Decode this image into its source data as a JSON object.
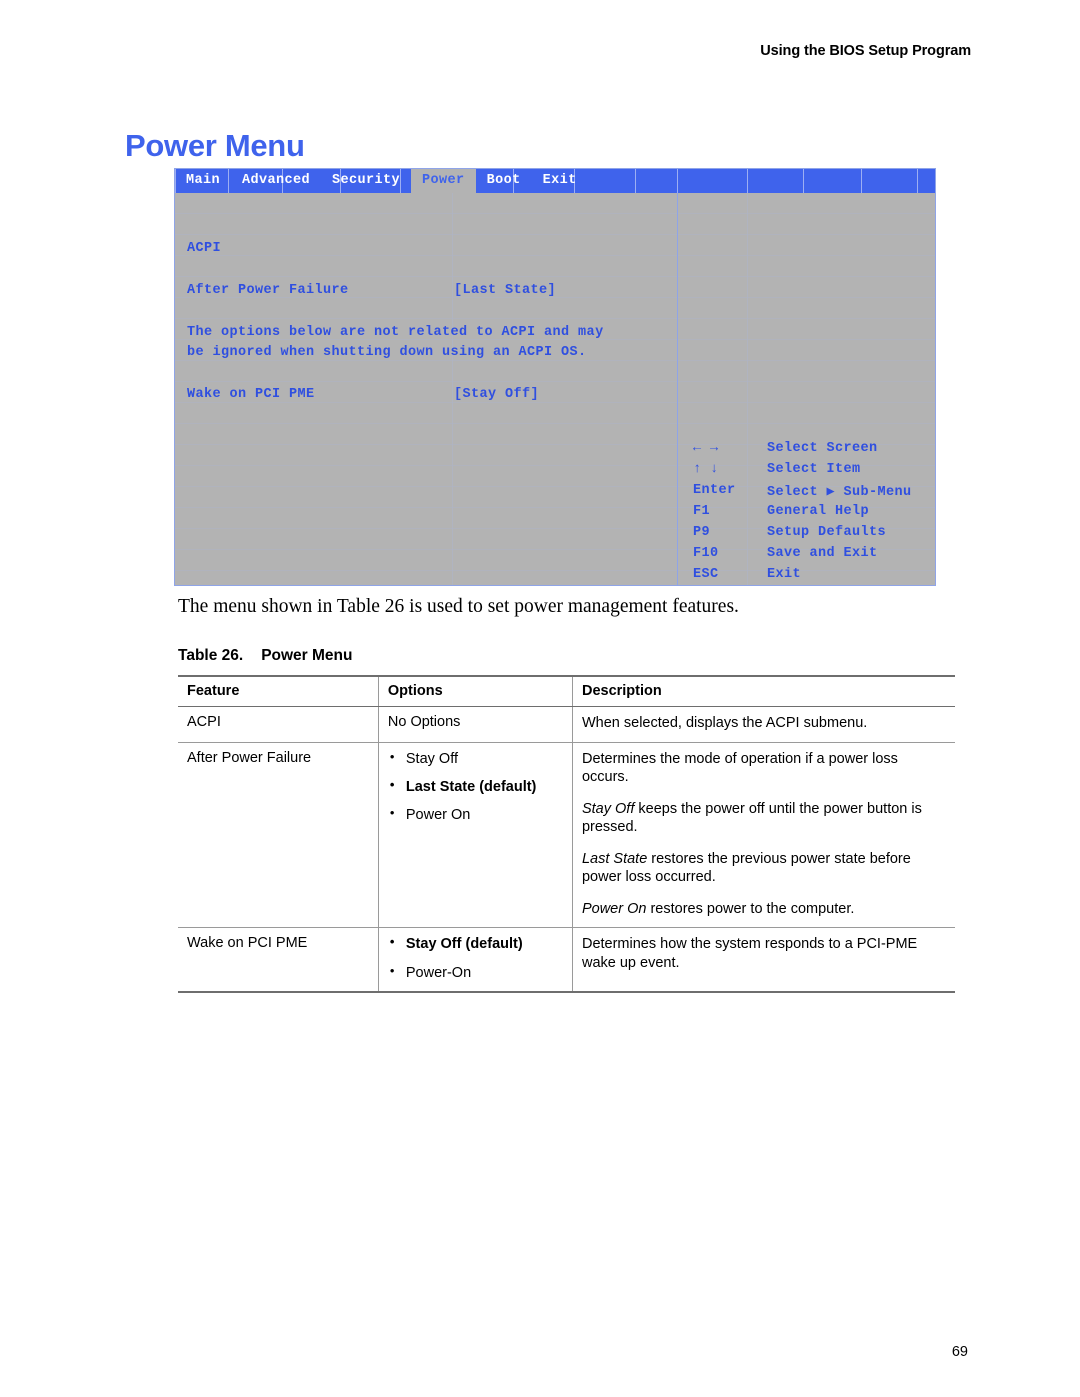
{
  "header": {
    "running_head": "Using the BIOS Setup Program"
  },
  "page_heading": "Power Menu",
  "bios_screen": {
    "tabs": [
      {
        "label": "Main",
        "selected": false
      },
      {
        "label": "Advanced",
        "selected": false
      },
      {
        "label": "Security",
        "selected": false
      },
      {
        "label": "Power",
        "selected": true
      },
      {
        "label": "Boot",
        "selected": false
      },
      {
        "label": "Exit",
        "selected": false
      }
    ],
    "items": [
      {
        "name": "ACPI",
        "value": ""
      },
      {
        "name": "After Power Failure",
        "value": "[Last State]"
      },
      {
        "name": "Wake on PCI PME",
        "value": "[Stay Off]"
      }
    ],
    "note_line1": "The options below are not related to ACPI and may",
    "note_line2": "be ignored when shutting down using an ACPI OS.",
    "help_keys": [
      {
        "key": "← →",
        "action": "Select Screen"
      },
      {
        "key": "↑ ↓",
        "action": "Select Item"
      },
      {
        "key": "Enter",
        "action": "Select ▶ Sub-Menu"
      },
      {
        "key": "F1",
        "action": "General Help"
      },
      {
        "key": "P9",
        "action": "Setup Defaults"
      },
      {
        "key": "F10",
        "action": "Save and Exit"
      },
      {
        "key": "ESC",
        "action": "Exit"
      }
    ],
    "colors": {
      "menubar_blue": "#3f63ec",
      "body_gray": "#b3b3b3",
      "text_blue": "#2f4fe0"
    }
  },
  "paragraph": "The menu shown in Table 26 is used to set power management features.",
  "table_caption": {
    "number": "Table 26.",
    "title": "Power Menu"
  },
  "table": {
    "headers": [
      "Feature",
      "Options",
      "Description"
    ],
    "rows": [
      {
        "feature": "ACPI",
        "options": [
          {
            "text": "No Options",
            "bullet": false,
            "bold": false
          }
        ],
        "description": [
          [
            {
              "t": "When selected, displays the ACPI submenu.",
              "i": false
            }
          ]
        ]
      },
      {
        "feature": "After Power Failure",
        "options": [
          {
            "text": "Stay Off",
            "bullet": true,
            "bold": false
          },
          {
            "text": "Last State (default)",
            "bullet": true,
            "bold": true
          },
          {
            "text": "Power On",
            "bullet": true,
            "bold": false
          }
        ],
        "description": [
          [
            {
              "t": "Determines the mode of operation if a power loss occurs.",
              "i": false
            }
          ],
          [
            {
              "t": "Stay Off",
              "i": true
            },
            {
              "t": " keeps the power off until the power button is pressed.",
              "i": false
            }
          ],
          [
            {
              "t": "Last State",
              "i": true
            },
            {
              "t": " restores the previous power state before power loss occurred.",
              "i": false
            }
          ],
          [
            {
              "t": "Power On",
              "i": true
            },
            {
              "t": " restores power to the computer.",
              "i": false
            }
          ]
        ]
      },
      {
        "feature": "Wake on PCI PME",
        "options": [
          {
            "text": "Stay Off (default)",
            "bullet": true,
            "bold": true
          },
          {
            "text": "Power-On",
            "bullet": true,
            "bold": false
          }
        ],
        "description": [
          [
            {
              "t": "Determines how the system responds to a PCI-PME wake up event.",
              "i": false
            }
          ]
        ]
      }
    ]
  },
  "page_number": "69"
}
